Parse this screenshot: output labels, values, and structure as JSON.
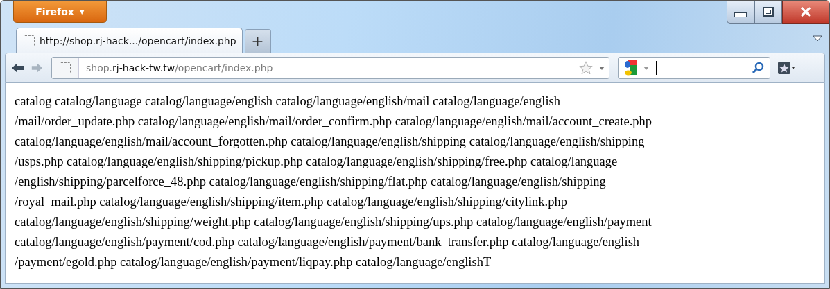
{
  "app_button": {
    "label": "Firefox",
    "caret": "▼"
  },
  "tabs": [
    {
      "title": "http://shop.rj-hack.../opencart/index.php",
      "selected": true
    }
  ],
  "new_tab": "+",
  "address": {
    "prefix": "shop.",
    "domain": "rj-hack-tw.tw",
    "path": "/opencart/index.php"
  },
  "page_lines": [
    "catalog catalog/language catalog/language/english catalog/language/english/mail catalog/language/english",
    "/mail/order_update.php catalog/language/english/mail/order_confirm.php catalog/language/english/mail/account_create.php",
    "catalog/language/english/mail/account_forgotten.php catalog/language/english/shipping catalog/language/english/shipping",
    "/usps.php catalog/language/english/shipping/pickup.php catalog/language/english/shipping/free.php catalog/language",
    "/english/shipping/parcelforce_48.php catalog/language/english/shipping/flat.php catalog/language/english/shipping",
    "/royal_mail.php catalog/language/english/shipping/item.php catalog/language/english/shipping/citylink.php",
    "catalog/language/english/shipping/weight.php catalog/language/english/shipping/ups.php catalog/language/english/payment",
    "catalog/language/english/payment/cod.php catalog/language/english/payment/bank_transfer.php catalog/language/english",
    "/payment/egold.php catalog/language/english/payment/liqpay.php catalog/language/englishT"
  ]
}
